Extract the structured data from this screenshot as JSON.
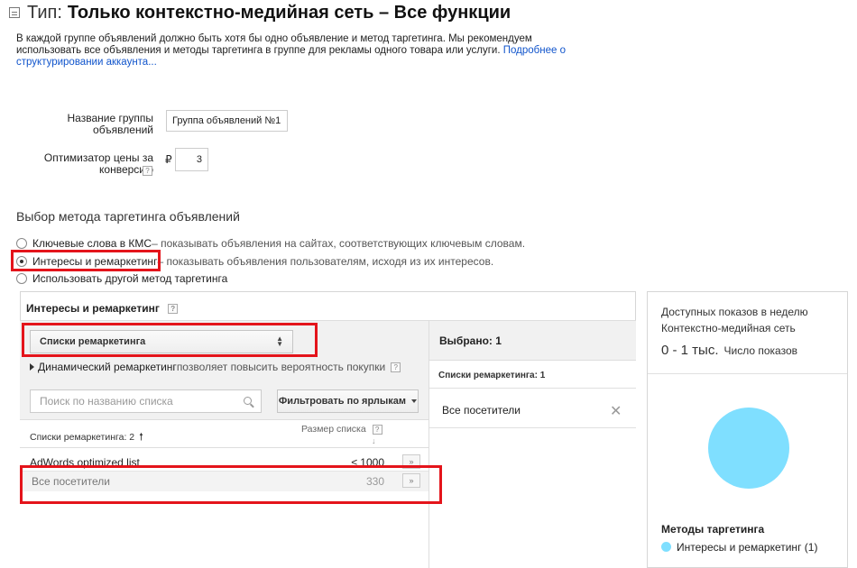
{
  "header": {
    "type_label": "Тип:",
    "title": "Только контекстно-медийная сеть – Все функции"
  },
  "intro": {
    "text": "В каждой группе объявлений должно быть хотя бы одно объявление и метод таргетинга. Мы рекомендуем использовать все объявления и методы таргетинга в группе для рекламы одного товара или услуги.",
    "link": "Подробнее о структурировании аккаунта..."
  },
  "form": {
    "group_name_label": "Название группы объявлений",
    "group_name_value": "Группа объявлений №1",
    "cpa_label": "Оптимизатор цены за конверсию",
    "currency": "₽",
    "cpa_value": "3",
    "help": "?"
  },
  "targeting": {
    "section_title": "Выбор метода таргетинга объявлений",
    "options": [
      {
        "label": "Ключевые слова в КМС",
        "desc": " – показывать объявления на сайтах, соответствующих ключевым словам.",
        "selected": false
      },
      {
        "label": "Интересы и ремаркетинг",
        "desc": " – показывать объявления пользователям, исходя из их интересов.",
        "selected": true
      },
      {
        "label": "Использовать другой метод таргетинга",
        "desc": "",
        "selected": false
      }
    ]
  },
  "panel": {
    "title": "Интересы и ремаркетинг",
    "select_value": "Списки ремаркетинга",
    "dynamic_link": "Динамический ремаркетинг",
    "dynamic_desc": " позволяет повысить вероятность покупки",
    "search_placeholder": "Поиск по названию списка",
    "filter_label": "Фильтровать по ярлыкам",
    "col_list": "Списки ремаркетинга: 2",
    "col_size": "Размер списка",
    "rows": [
      {
        "name": "AdWords optimized list",
        "size": "≤ 1000",
        "arrow": "»"
      },
      {
        "name": "Все посетители",
        "size": "330",
        "arrow": "»"
      }
    ],
    "selected_title": "Выбрано: 1",
    "selected_sub": "Списки ремаркетинга: 1",
    "selected_items": [
      "Все посетители"
    ],
    "remove_icon": "✕"
  },
  "side": {
    "title": "Доступных показов в неделю",
    "subtitle": "Контекстно-медийная сеть",
    "range": "0 - 1 тыс.",
    "range_label": "Число показов",
    "legend_title": "Методы таргетинга",
    "legend_item": "Интересы и ремаркетинг (1)",
    "pie_color": "#7fdfff"
  }
}
